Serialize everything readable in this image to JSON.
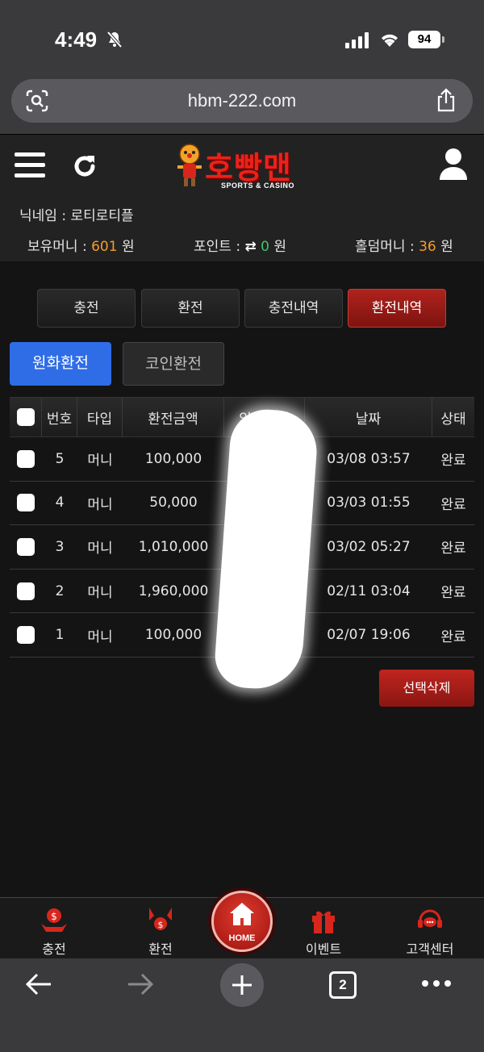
{
  "status": {
    "time": "4:49",
    "battery": "94"
  },
  "browser": {
    "url": "hbm-222.com",
    "tab_count": "2"
  },
  "site": {
    "logo_text": "호빵맨",
    "logo_sub": "SPORTS & CASINO",
    "nickname_label": "닉네임 : 로티로티플",
    "money_label": "보유머니 :",
    "money_value": "601",
    "money_unit": "원",
    "point_label": "포인트 :",
    "point_icon": "⇄",
    "point_value": "0",
    "point_unit": "원",
    "holdem_label": "홀덤머니 :",
    "holdem_value": "36",
    "holdem_unit": "원",
    "orange": "#f39c2c",
    "accent_red": "#b0221d",
    "accent_blue": "#2f6de6"
  },
  "tabs": [
    "충전",
    "환전",
    "충전내역",
    "환전내역"
  ],
  "subtabs": [
    "원화환전",
    "코인환전"
  ],
  "table": {
    "headers": [
      "번호",
      "타입",
      "환전금액",
      "입금자명",
      "날짜",
      "상태"
    ],
    "rows": [
      {
        "no": "5",
        "type": "머니",
        "amount": "100,000",
        "date": "03/08 03:57",
        "status": "완료"
      },
      {
        "no": "4",
        "type": "머니",
        "amount": "50,000",
        "date": "03/03 01:55",
        "status": "완료"
      },
      {
        "no": "3",
        "type": "머니",
        "amount": "1,010,000",
        "date": "03/02 05:27",
        "status": "완료"
      },
      {
        "no": "2",
        "type": "머니",
        "amount": "1,960,000",
        "date": "02/11 03:04",
        "status": "완료"
      },
      {
        "no": "1",
        "type": "머니",
        "amount": "100,000",
        "date": "02/07 19:06",
        "status": "완료"
      }
    ]
  },
  "delete_button": "선택삭제",
  "bottom_nav": {
    "charge": "충전",
    "exchange": "환전",
    "home": "HOME",
    "event": "이벤트",
    "support": "고객센터"
  }
}
